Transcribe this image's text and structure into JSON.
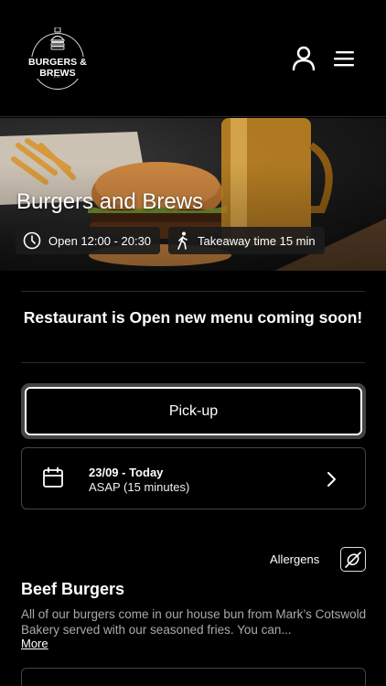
{
  "header": {
    "logo": {
      "brand": "BURGERS & BREWS",
      "tagline": "EST"
    },
    "account_icon": "user-icon",
    "menu_icon": "hamburger-menu-icon"
  },
  "hero": {
    "title": "Burgers and Brews",
    "hours": "Open 12:00 - 20:30",
    "hours_icon": "clock-icon",
    "takeaway": "Takeaway time 15 min",
    "takeaway_icon": "walking-icon"
  },
  "notice": "Restaurant is Open new menu coming soon!",
  "order_type": {
    "label": "Pick-up"
  },
  "schedule": {
    "date": "23/09 - Today",
    "time": "ASAP (15 minutes)",
    "icon": "calendar-icon"
  },
  "allergens": {
    "label": "Allergens",
    "icon": "allergen-filter-icon"
  },
  "category": {
    "title": "Beef Burgers",
    "description": "All of our burgers come in our house bun from Mark’s Cotswold Bakery served with our seasoned fries. You can...",
    "more": "More"
  },
  "colors": {
    "background": "#000000",
    "text": "#ffffff",
    "muted": "#aaaaaa",
    "border": "#444444"
  }
}
